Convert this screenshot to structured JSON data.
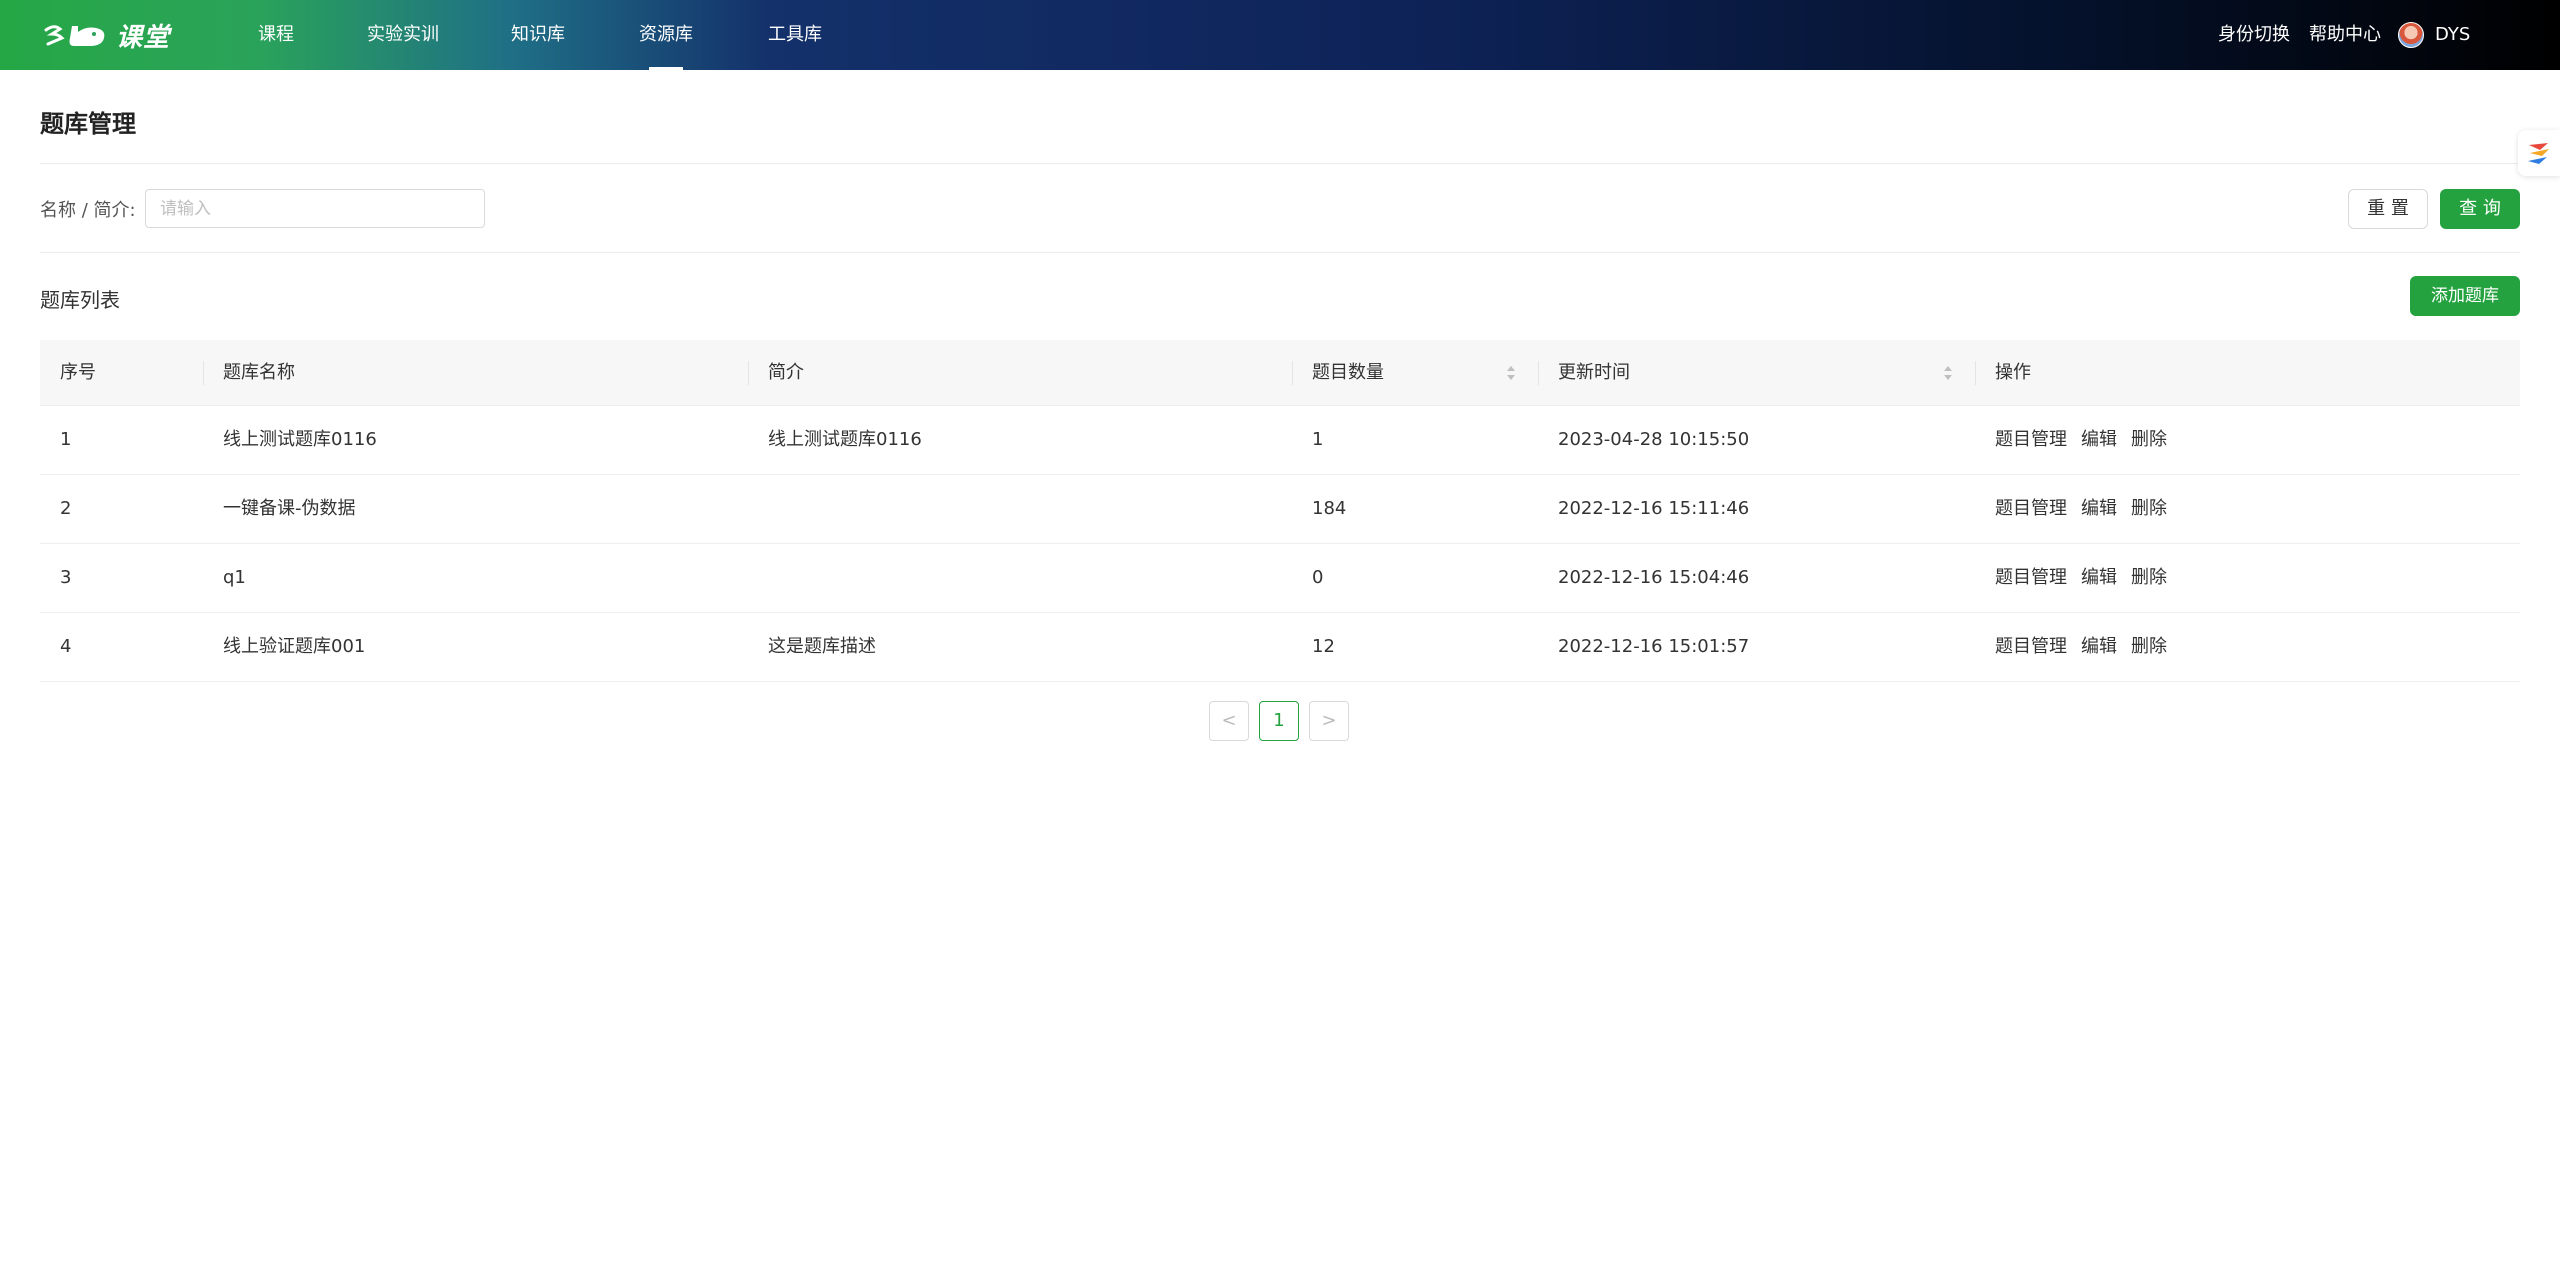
{
  "header": {
    "logo_text": "课堂",
    "nav": [
      {
        "label": "课程",
        "active": false
      },
      {
        "label": "实验实训",
        "active": false
      },
      {
        "label": "知识库",
        "active": false
      },
      {
        "label": "资源库",
        "active": true
      },
      {
        "label": "工具库",
        "active": false
      }
    ],
    "identity_switch": "身份切换",
    "help_center": "帮助中心",
    "username": "DYS"
  },
  "page": {
    "title": "题库管理"
  },
  "filter": {
    "label": "名称 / 简介:",
    "placeholder": "请输入",
    "value": "",
    "reset_label": "重 置",
    "query_label": "查 询"
  },
  "list": {
    "title": "题库列表",
    "add_label": "添加题库",
    "columns": [
      "序号",
      "题库名称",
      "简介",
      "题目数量",
      "更新时间",
      "操作"
    ],
    "rows": [
      {
        "index": "1",
        "name": "线上测试题库0116",
        "desc": "线上测试题库0116",
        "count": "1",
        "updated": "2023-04-28 10:15:50"
      },
      {
        "index": "2",
        "name": "一键备课-伪数据",
        "desc": "",
        "count": "184",
        "updated": "2022-12-16 15:11:46"
      },
      {
        "index": "3",
        "name": "q1",
        "desc": "",
        "count": "0",
        "updated": "2022-12-16 15:04:46"
      },
      {
        "index": "4",
        "name": "线上验证题库001",
        "desc": "这是题库描述",
        "count": "12",
        "updated": "2022-12-16 15:01:57"
      }
    ],
    "actions": [
      "题目管理",
      "编辑",
      "删除"
    ]
  },
  "pagination": {
    "prev": "<",
    "current": "1",
    "next": ">"
  },
  "colors": {
    "accent": "#24a23f"
  }
}
